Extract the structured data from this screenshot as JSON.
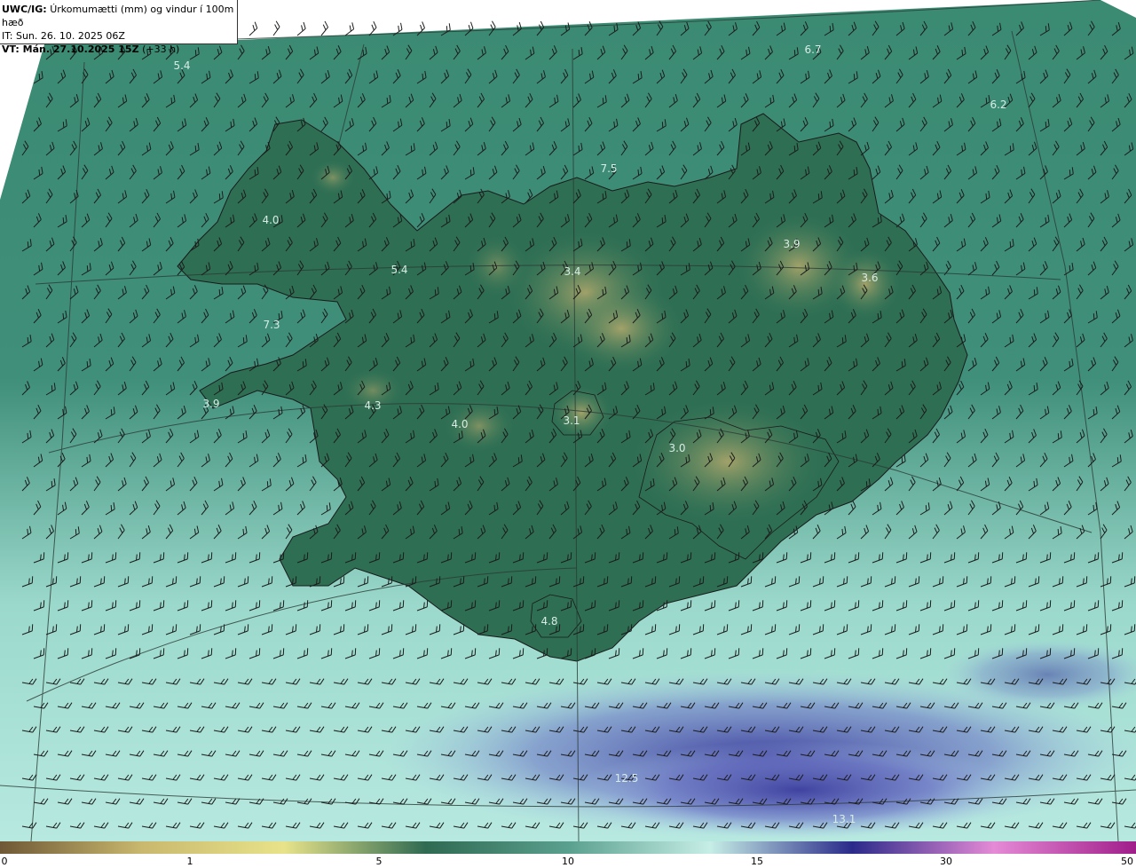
{
  "header": {
    "product": "UWC/IG:",
    "product_desc": "Úrkomumætti (mm) og vindur í 100m hæð",
    "issue_time": "IT: Sun. 26. 10. 2025 06Z",
    "valid_label": "VT: Mán. 27.10.2025 15Z",
    "valid_offset": "(+33 h)"
  },
  "map_values": [
    "5.4",
    "6.7",
    "6.2",
    "7.5",
    "4.0",
    "5.4",
    "7.3",
    "3.4",
    "3.9",
    "3.6",
    "3.9",
    "4.3",
    "4.0",
    "3.1",
    "3.0",
    "4.8",
    "12.5",
    "13.1"
  ],
  "colorbar": {
    "stops": [
      "#6e5836",
      "#c9b86e",
      "#e8e38a",
      "#2f6a52",
      "#5aa08e",
      "#c6eee6",
      "#2a2a8a",
      "#e58ad6",
      "#a01d8a"
    ],
    "ticks": [
      "0",
      "1",
      "5",
      "10",
      "15",
      "30",
      "50"
    ]
  },
  "colors": {
    "land_low": "#2f6f55",
    "land_high": "#9ea067",
    "sea_north": "#3f8c76",
    "sea_south": "#a9e0d6",
    "heavy_precip": "#4d4fae",
    "coastline": "#1a1a1a"
  }
}
